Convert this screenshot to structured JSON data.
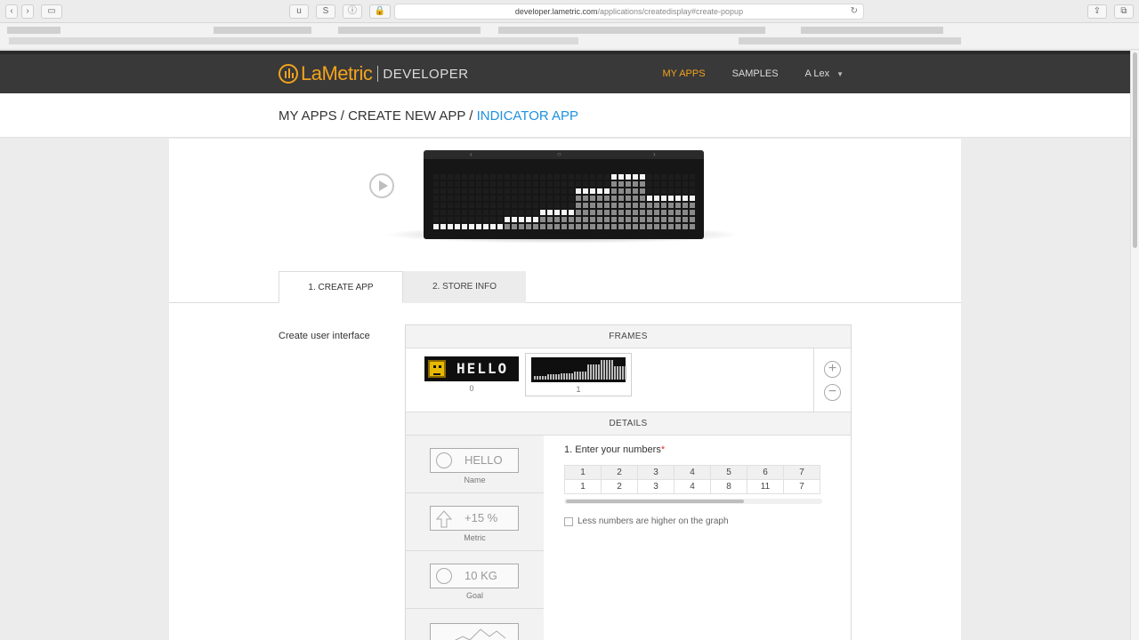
{
  "browser": {
    "url_host": "developer.lametric.com",
    "url_path": "/applications/createdisplay#create-popup",
    "ext_u": "u",
    "ext_s": "S"
  },
  "nav": {
    "logo_text": "LaMetric",
    "logo_sub": "DEVELOPER",
    "my_apps": "MY APPS",
    "samples": "SAMPLES",
    "user": "A Lex"
  },
  "breadcrumb": {
    "part1": "MY APPS / ",
    "part2": "CREATE NEW APP / ",
    "current": "INDICATOR APP"
  },
  "tabs": {
    "create_app": "1. CREATE APP",
    "store_info": "2. STORE INFO"
  },
  "builder": {
    "label": "Create user interface",
    "frames_header": "FRAMES",
    "frames": [
      {
        "text": "HELLO",
        "index": "0"
      },
      {
        "text": "",
        "index": "1"
      }
    ],
    "add_label": "+",
    "remove_label": "−",
    "details_header": "DETAILS"
  },
  "widgets": [
    {
      "box_text": "HELLO",
      "caption": "Name"
    },
    {
      "box_text": "+15 %",
      "caption": "Metric"
    },
    {
      "box_text": "10 KG",
      "caption": "Goal"
    }
  ],
  "details": {
    "question": "1. Enter your numbers",
    "required_mark": "*",
    "columns": [
      "1",
      "2",
      "3",
      "4",
      "5",
      "6",
      "7"
    ],
    "values": [
      "1",
      "2",
      "3",
      "4",
      "8",
      "11",
      "7"
    ],
    "checkbox_label": "Less numbers are higher on the graph",
    "checkbox_checked": false
  },
  "colors": {
    "accent": "#f2a31c",
    "link": "#1e90e0",
    "nav_bg": "#3a3939"
  }
}
